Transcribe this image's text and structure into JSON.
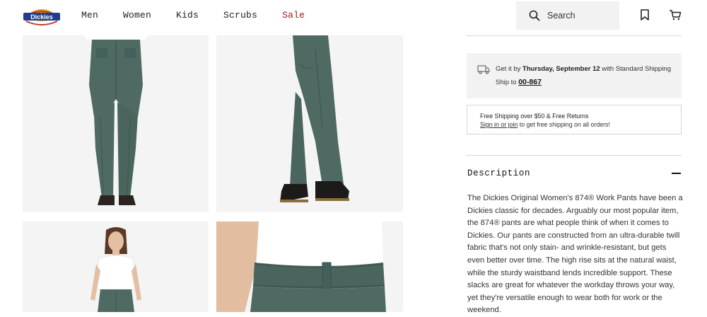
{
  "brand": {
    "logo_text": "Dickies"
  },
  "nav": {
    "items": [
      {
        "label": "Men"
      },
      {
        "label": "Women"
      },
      {
        "label": "Kids"
      },
      {
        "label": "Scrubs"
      },
      {
        "label": "Sale"
      }
    ],
    "sale_color": "#a4161a"
  },
  "search": {
    "label": "Search"
  },
  "icons": {
    "search": "search-icon",
    "wishlist": "bookmark-icon",
    "cart": "cart-icon",
    "shipping": "truck-icon",
    "collapse": "minus-icon"
  },
  "shipping": {
    "prefix": "Get it by",
    "date": "Thursday, September 12",
    "suffix": "with Standard Shipping",
    "ship_to_label": "Ship to",
    "zip": "00-867"
  },
  "promo": {
    "line1": "Free Shipping over $50 & Free Returns",
    "link_text": "Sign in or join",
    "line2_rest": "to get free shipping on all orders!"
  },
  "description": {
    "title": "Description",
    "body": "The Dickies Original Women's 874® Work Pants have been a Dickies classic for decades. Arguably our most popular item, the 874® pants are what people think of when it comes to Dickies. Our pants are constructed from an ultra-durable twill fabric that's not only stain- and wrinkle-resistant, but gets even better over time. The high rise sits at the natural waist, while the sturdy waistband lends incredible support. These slacks are great for whatever the workday throws your way, yet they're versatile enough to wear both for work or the weekend."
  },
  "colors": {
    "pants": "#4f6a63",
    "pants_dark": "#3f5751",
    "panel": "#f2f2f2"
  }
}
